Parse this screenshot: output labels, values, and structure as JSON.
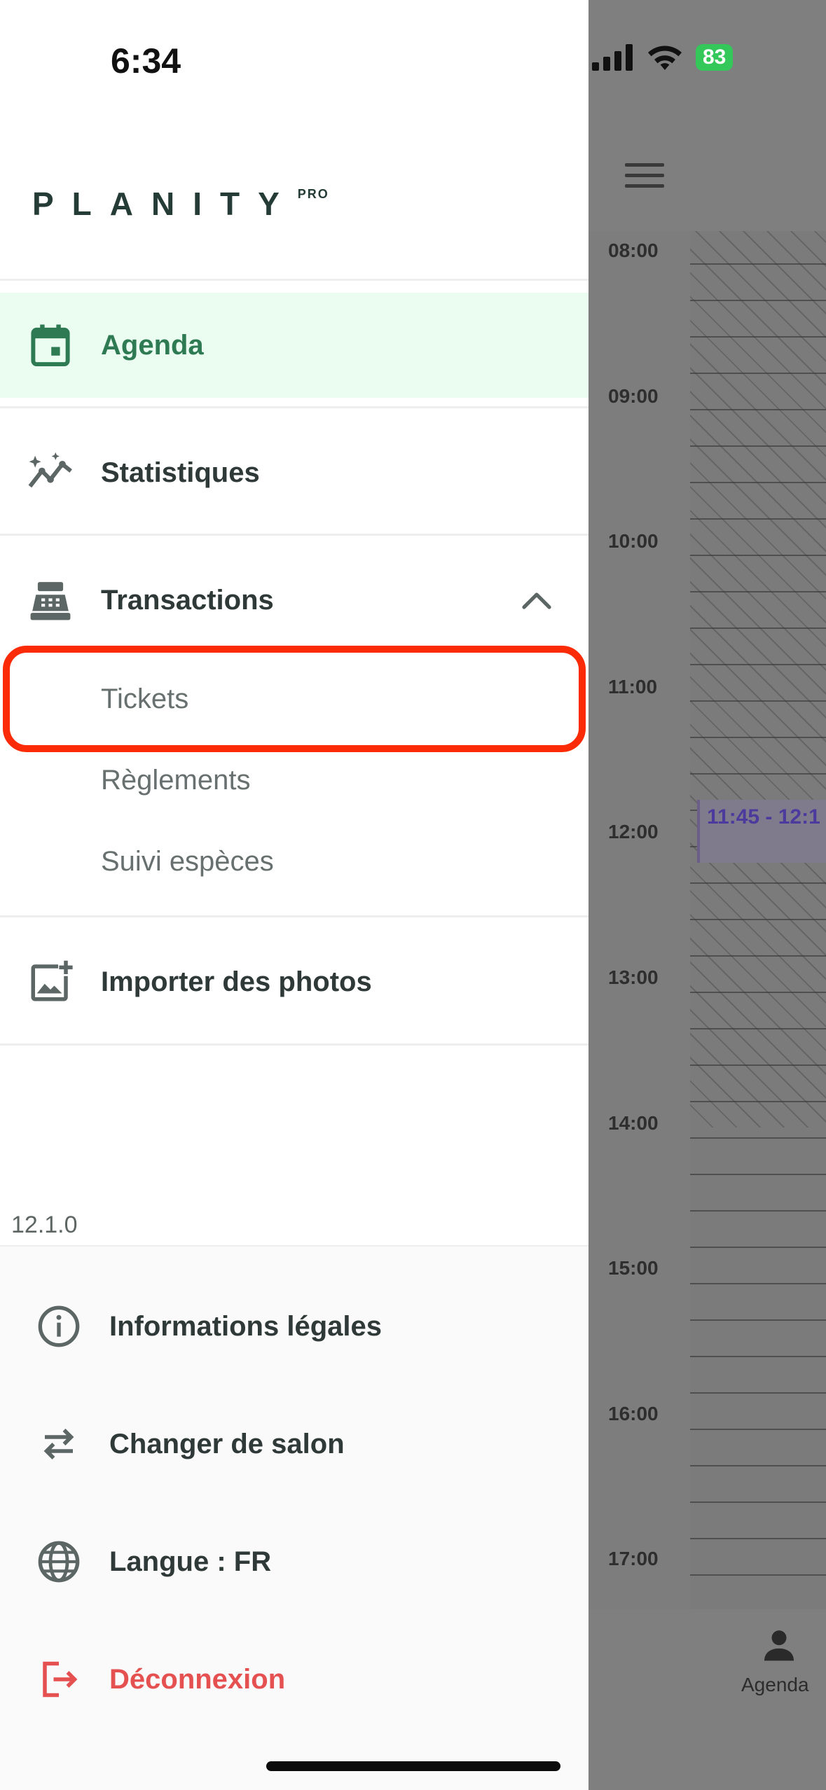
{
  "status_bar": {
    "time": "6:34",
    "battery": "83"
  },
  "logo": {
    "text": "PLANITY",
    "superscript": "PRO"
  },
  "menu": {
    "agenda": "Agenda",
    "statistiques": "Statistiques",
    "transactions": "Transactions",
    "transactions_sub": [
      "Tickets",
      "Règlements",
      "Suivi espèces"
    ],
    "importer_photos": "Importer des photos"
  },
  "version": "12.1.0",
  "bottom_menu": {
    "informations_legales": "Informations légales",
    "changer_salon": "Changer de salon",
    "langue": "Langue : FR",
    "deconnexion": "Déconnexion"
  },
  "background_agenda": {
    "hours": [
      "08:00",
      "09:00",
      "10:00",
      "11:00",
      "12:00",
      "13:00",
      "14:00",
      "15:00",
      "16:00",
      "17:00"
    ],
    "event_label": "11:45 - 12:1",
    "tab_label": "Agenda"
  },
  "colors": {
    "accent_green": "#2d7a53",
    "active_bg": "#ebfcf0",
    "danger": "#e55151",
    "highlight_border": "#fa2b06",
    "battery": "#34c759"
  }
}
